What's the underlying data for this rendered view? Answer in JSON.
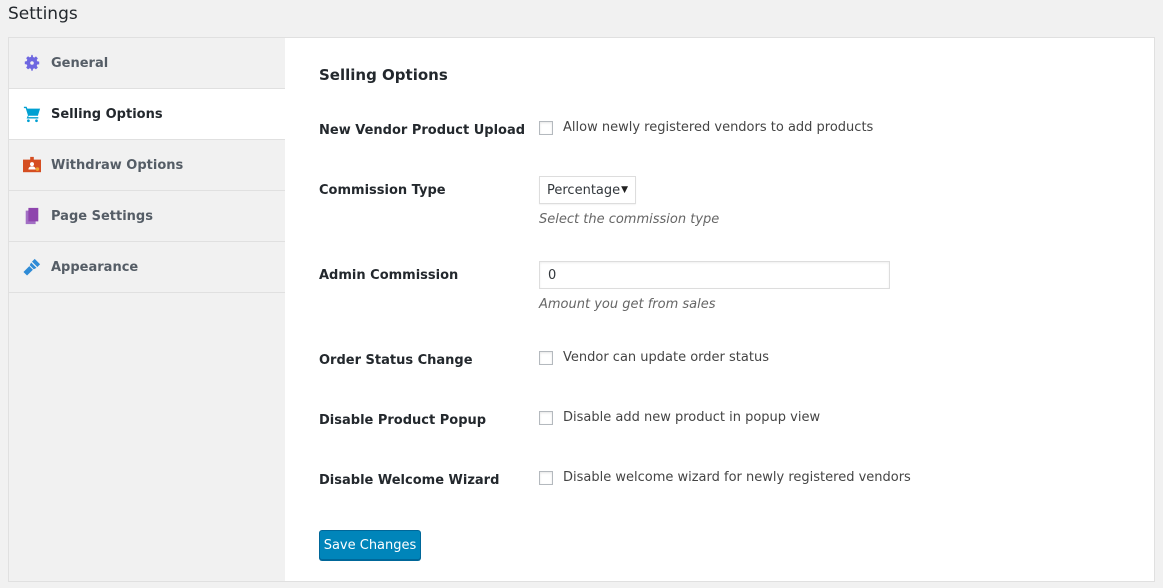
{
  "page": {
    "title": "Settings"
  },
  "tabs": [
    {
      "label": "General",
      "icon": "gear-icon",
      "color": "#6e67e0"
    },
    {
      "label": "Selling Options",
      "icon": "cart-icon",
      "color": "#00a0d2"
    },
    {
      "label": "Withdraw Options",
      "icon": "withdraw-icon",
      "color": "#d54e21"
    },
    {
      "label": "Page Settings",
      "icon": "pages-icon",
      "color": "#8e44ad"
    },
    {
      "label": "Appearance",
      "icon": "brush-icon",
      "color": "#2e8bd6"
    }
  ],
  "section": {
    "title": "Selling Options",
    "new_vendor": {
      "label": "New Vendor Product Upload",
      "option": "Allow newly registered vendors to add products"
    },
    "commission_type": {
      "label": "Commission Type",
      "value": "Percentage",
      "desc": "Select the commission type"
    },
    "admin_commission": {
      "label": "Admin Commission",
      "value": "0",
      "desc": "Amount you get from sales"
    },
    "order_status": {
      "label": "Order Status Change",
      "option": "Vendor can update order status"
    },
    "disable_popup": {
      "label": "Disable Product Popup",
      "option": "Disable add new product in popup view"
    },
    "disable_wizard": {
      "label": "Disable Welcome Wizard",
      "option": "Disable welcome wizard for newly registered vendors"
    },
    "save_label": "Save Changes"
  }
}
